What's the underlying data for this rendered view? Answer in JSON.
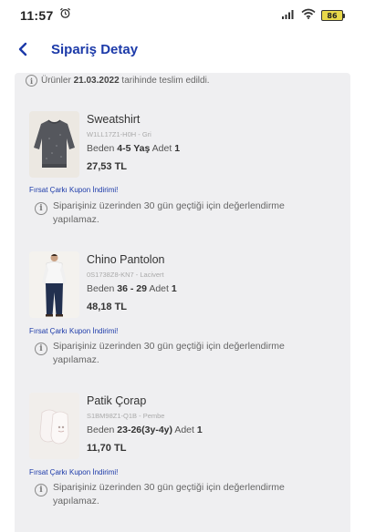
{
  "status_bar": {
    "time": "11:57",
    "battery": "86"
  },
  "header": {
    "title": "Sipariş Detay"
  },
  "delivery": {
    "prefix": "Ürünler ",
    "date": "21.03.2022",
    "suffix": " tarihinde teslim edildi."
  },
  "items": [
    {
      "name": "Sweatshirt",
      "code": "W1LL17Z1-H0H - Gri",
      "size_label": "Beden",
      "size": "4-5 Yaş",
      "qty_label": "Adet",
      "qty": "1",
      "price": "27,53 TL",
      "coupon": "Fırsat Çarkı Kupon İndirimi!",
      "eval_note": "Siparişiniz üzerinden 30 gün geçtiği için değerlendirme yapılamaz."
    },
    {
      "name": "Chino Pantolon",
      "code": "0S1738Z8-KN7 - Lacivert",
      "size_label": "Beden",
      "size": "36 - 29",
      "qty_label": "Adet",
      "qty": "1",
      "price": "48,18 TL",
      "coupon": "Fırsat Çarkı Kupon İndirimi!",
      "eval_note": "Siparişiniz üzerinden 30 gün geçtiği için değerlendirme yapılamaz."
    },
    {
      "name": "Patik Çorap",
      "code": "S1BM98Z1-Q1B - Pembe",
      "size_label": "Beden",
      "size": "23-26(3y-4y)",
      "qty_label": "Adet",
      "qty": "1",
      "price": "11,70 TL",
      "coupon": "Fırsat Çarkı Kupon İndirimi!",
      "eval_note": "Siparişiniz üzerinden 30 gün geçtiği için değerlendirme yapılamaz."
    }
  ]
}
